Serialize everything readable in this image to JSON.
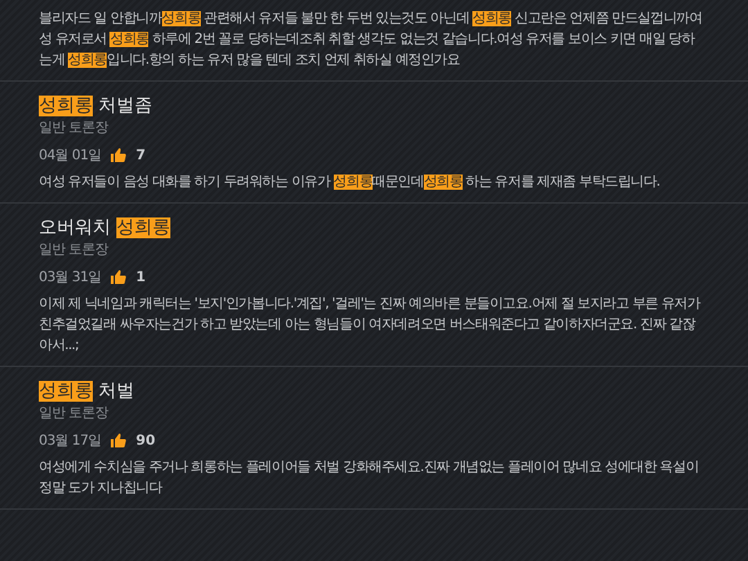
{
  "intro": {
    "body": [
      {
        "text": "블리자드 일 안합니까",
        "highlight": false
      },
      {
        "text": "성희롱",
        "highlight": true
      },
      {
        "text": " 관련해서 유저들 불만 한 두번 있는것도 아닌데 ",
        "highlight": false
      },
      {
        "text": "성희롱",
        "highlight": true
      },
      {
        "text": " 신고란은 언제쯤 만드실껍니까여성 유저로서 ",
        "highlight": false
      },
      {
        "text": "성희롱",
        "highlight": true
      },
      {
        "text": " 하루에 2번 꼴로 당하는데조취 취할 생각도 없는것 같습니다.여성 유저를 보이스 키면 매일 당하는게 ",
        "highlight": false
      },
      {
        "text": "성희롱",
        "highlight": true
      },
      {
        "text": "입니다.항의 하는 유저 많을 텐데 조치 언제 취하실 예정인가요",
        "highlight": false
      }
    ]
  },
  "posts": [
    {
      "title": [
        {
          "text": "성희롱",
          "highlight": true
        },
        {
          "text": " 처벌좀",
          "highlight": false
        }
      ],
      "board": "일반 토론장",
      "date": "04월 01일",
      "likes": "7",
      "body": [
        {
          "text": "여성 유저들이 음성 대화를 하기 두려워하는 이유가 ",
          "highlight": false
        },
        {
          "text": "성희롱",
          "highlight": true
        },
        {
          "text": "때문인데",
          "highlight": false
        },
        {
          "text": "성희롱",
          "highlight": true
        },
        {
          "text": " 하는 유저를 제재좀 부탁드립니다.",
          "highlight": false
        }
      ]
    },
    {
      "title": [
        {
          "text": "오버워치 ",
          "highlight": false
        },
        {
          "text": "성희롱",
          "highlight": true
        }
      ],
      "board": "일반 토론장",
      "date": "03월 31일",
      "likes": "1",
      "body": [
        {
          "text": "이제 제 닉네임과 캐릭터는 '보지'인가봅니다.'계집', '걸레'는 진짜 예의바른 분들이고요.어제 절 보지라고 부른 유저가 친추걸었길래 싸우자는건가 하고 받았는데 아는 형님들이 여자데려오면 버스태워준다고 같이하자더군요. 진짜 같잖아서...;",
          "highlight": false
        }
      ]
    },
    {
      "title": [
        {
          "text": "성희롱",
          "highlight": true
        },
        {
          "text": " 처벌",
          "highlight": false
        }
      ],
      "board": "일반 토론장",
      "date": "03월 17일",
      "likes": "90",
      "body": [
        {
          "text": "여성에게 수치심을 주거나 희롱하는 플레이어들 처벌 강화해주세요.진짜 개념없는 플레이어 많네요 성에대한 욕설이 정말 도가 지나칩니다",
          "highlight": false
        }
      ]
    }
  ]
}
